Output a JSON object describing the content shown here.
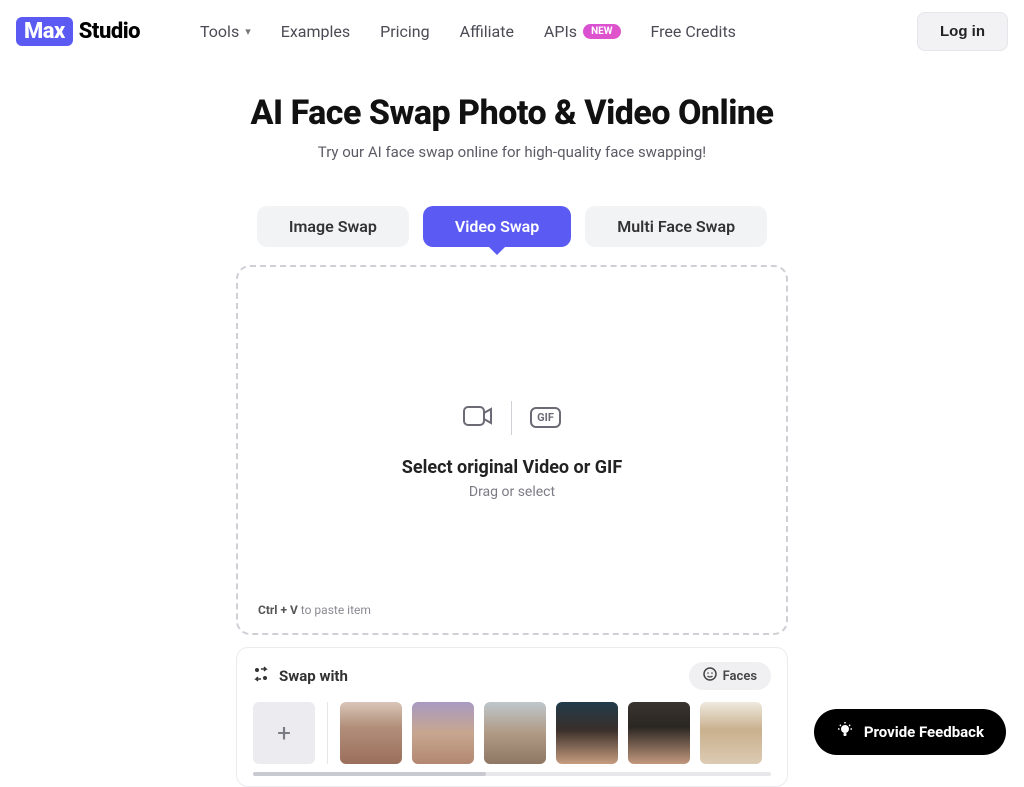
{
  "brand": {
    "badge": "Max",
    "text": "Studio"
  },
  "nav": {
    "tools": "Tools",
    "examples": "Examples",
    "pricing": "Pricing",
    "affiliate": "Affiliate",
    "apis": "APIs",
    "apis_badge": "NEW",
    "free_credits": "Free Credits"
  },
  "login": "Log in",
  "hero": {
    "title": "AI Face Swap Photo & Video Online",
    "subtitle": "Try our AI face swap online for high-quality face swapping!"
  },
  "tabs": {
    "image": "Image Swap",
    "video": "Video Swap",
    "multi": "Multi Face Swap"
  },
  "dropzone": {
    "gif_badge": "GIF",
    "title": "Select original Video or GIF",
    "subtitle": "Drag or select",
    "hint_key": "Ctrl + V",
    "hint_rest": " to paste item"
  },
  "swap": {
    "title": "Swap with",
    "faces_label": "Faces"
  },
  "feedback": "Provide Feedback"
}
